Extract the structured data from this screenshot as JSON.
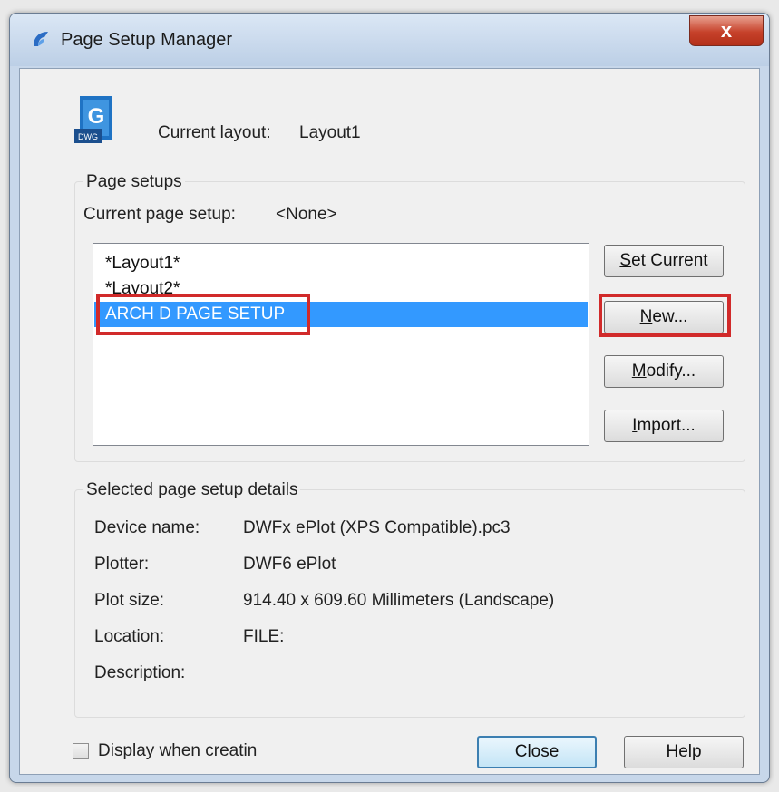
{
  "window": {
    "title": "Page Setup Manager",
    "close_glyph": "x"
  },
  "current_layout": {
    "label": "Current layout:",
    "value": "Layout1"
  },
  "dwg_icon": {
    "letter": "G",
    "caption": "DWG"
  },
  "page_setups": {
    "group_title_prefix": "P",
    "group_title_rest": "age setups",
    "current_label": "Current page setup:",
    "current_value": "<None>",
    "items": [
      {
        "label": "*Layout1*",
        "selected": false
      },
      {
        "label": "*Layout2*",
        "selected": false
      },
      {
        "label": "ARCH D PAGE SETUP",
        "selected": true
      }
    ]
  },
  "buttons": {
    "set_current": {
      "key": "S",
      "rest": "et Current"
    },
    "new": {
      "key": "N",
      "rest": "ew..."
    },
    "modify": {
      "key": "M",
      "rest": "odify..."
    },
    "import": {
      "key": "I",
      "rest": "mport..."
    },
    "close": {
      "key": "C",
      "rest": "lose"
    },
    "help": {
      "key": "H",
      "rest": "elp"
    }
  },
  "details": {
    "group_title": "Selected page setup details",
    "rows": [
      {
        "label": "Device name:",
        "value": "DWFx ePlot (XPS Compatible).pc3"
      },
      {
        "label": "Plotter:",
        "value": "DWF6 ePlot"
      },
      {
        "label": "Plot size:",
        "value": "914.40 x 609.60 Millimeters (Landscape)"
      },
      {
        "label": "Location:",
        "value": "FILE:"
      },
      {
        "label": "Description:",
        "value": ""
      }
    ]
  },
  "display_when_creating": {
    "label": "Display when creatin",
    "checked": false
  },
  "colors": {
    "selection": "#3399ff",
    "highlight": "#d12a2a",
    "title_close": "#c6412a"
  },
  "icons": {
    "app": "gstarcad-app-icon",
    "file": "dwg-file-icon"
  }
}
